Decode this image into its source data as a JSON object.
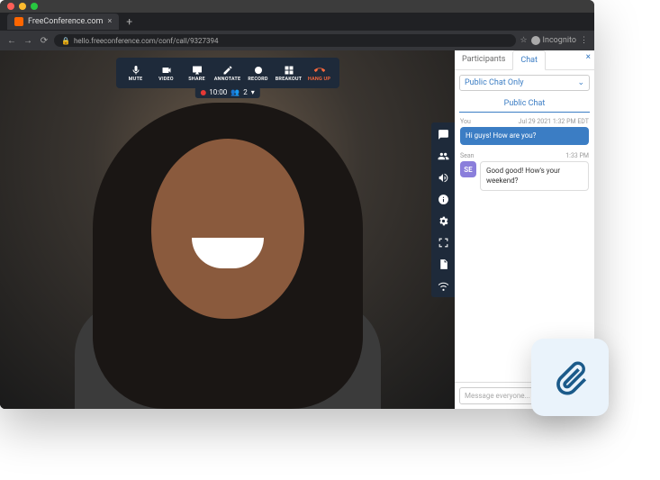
{
  "browser": {
    "tab_title": "FreeConference.com",
    "url": "hello.freeconference.com/conf/call/9327394",
    "profile_label": "Incognito"
  },
  "toolbar": [
    {
      "name": "mute-button",
      "label": "MUTE"
    },
    {
      "name": "video-button",
      "label": "VIDEO"
    },
    {
      "name": "share-button",
      "label": "SHARE"
    },
    {
      "name": "annotate-button",
      "label": "ANNOTATE"
    },
    {
      "name": "record-button",
      "label": "RECORD"
    },
    {
      "name": "breakout-button",
      "label": "BREAKOUT"
    },
    {
      "name": "hangup-button",
      "label": "HANG UP"
    }
  ],
  "status": {
    "time": "10:00",
    "participant_count": "2"
  },
  "side_rail": [
    "chat-icon",
    "participants-icon",
    "announce-icon",
    "info-icon",
    "settings-icon",
    "fullscreen-icon",
    "document-icon",
    "wifi-icon"
  ],
  "panel": {
    "tabs": {
      "participants": "Participants",
      "chat": "Chat"
    },
    "filter": "Public Chat Only",
    "public_header": "Public Chat",
    "messages": {
      "me_label": "You",
      "me_time": "Jul 29 2021 1:32 PM EDT",
      "me_text": "Hi guys! How are you?",
      "other_name": "Sean",
      "other_initials": "SE",
      "other_time": "1:33 PM",
      "other_text": "Good good! How's your weekend?"
    },
    "compose_placeholder": "Message everyone..."
  }
}
